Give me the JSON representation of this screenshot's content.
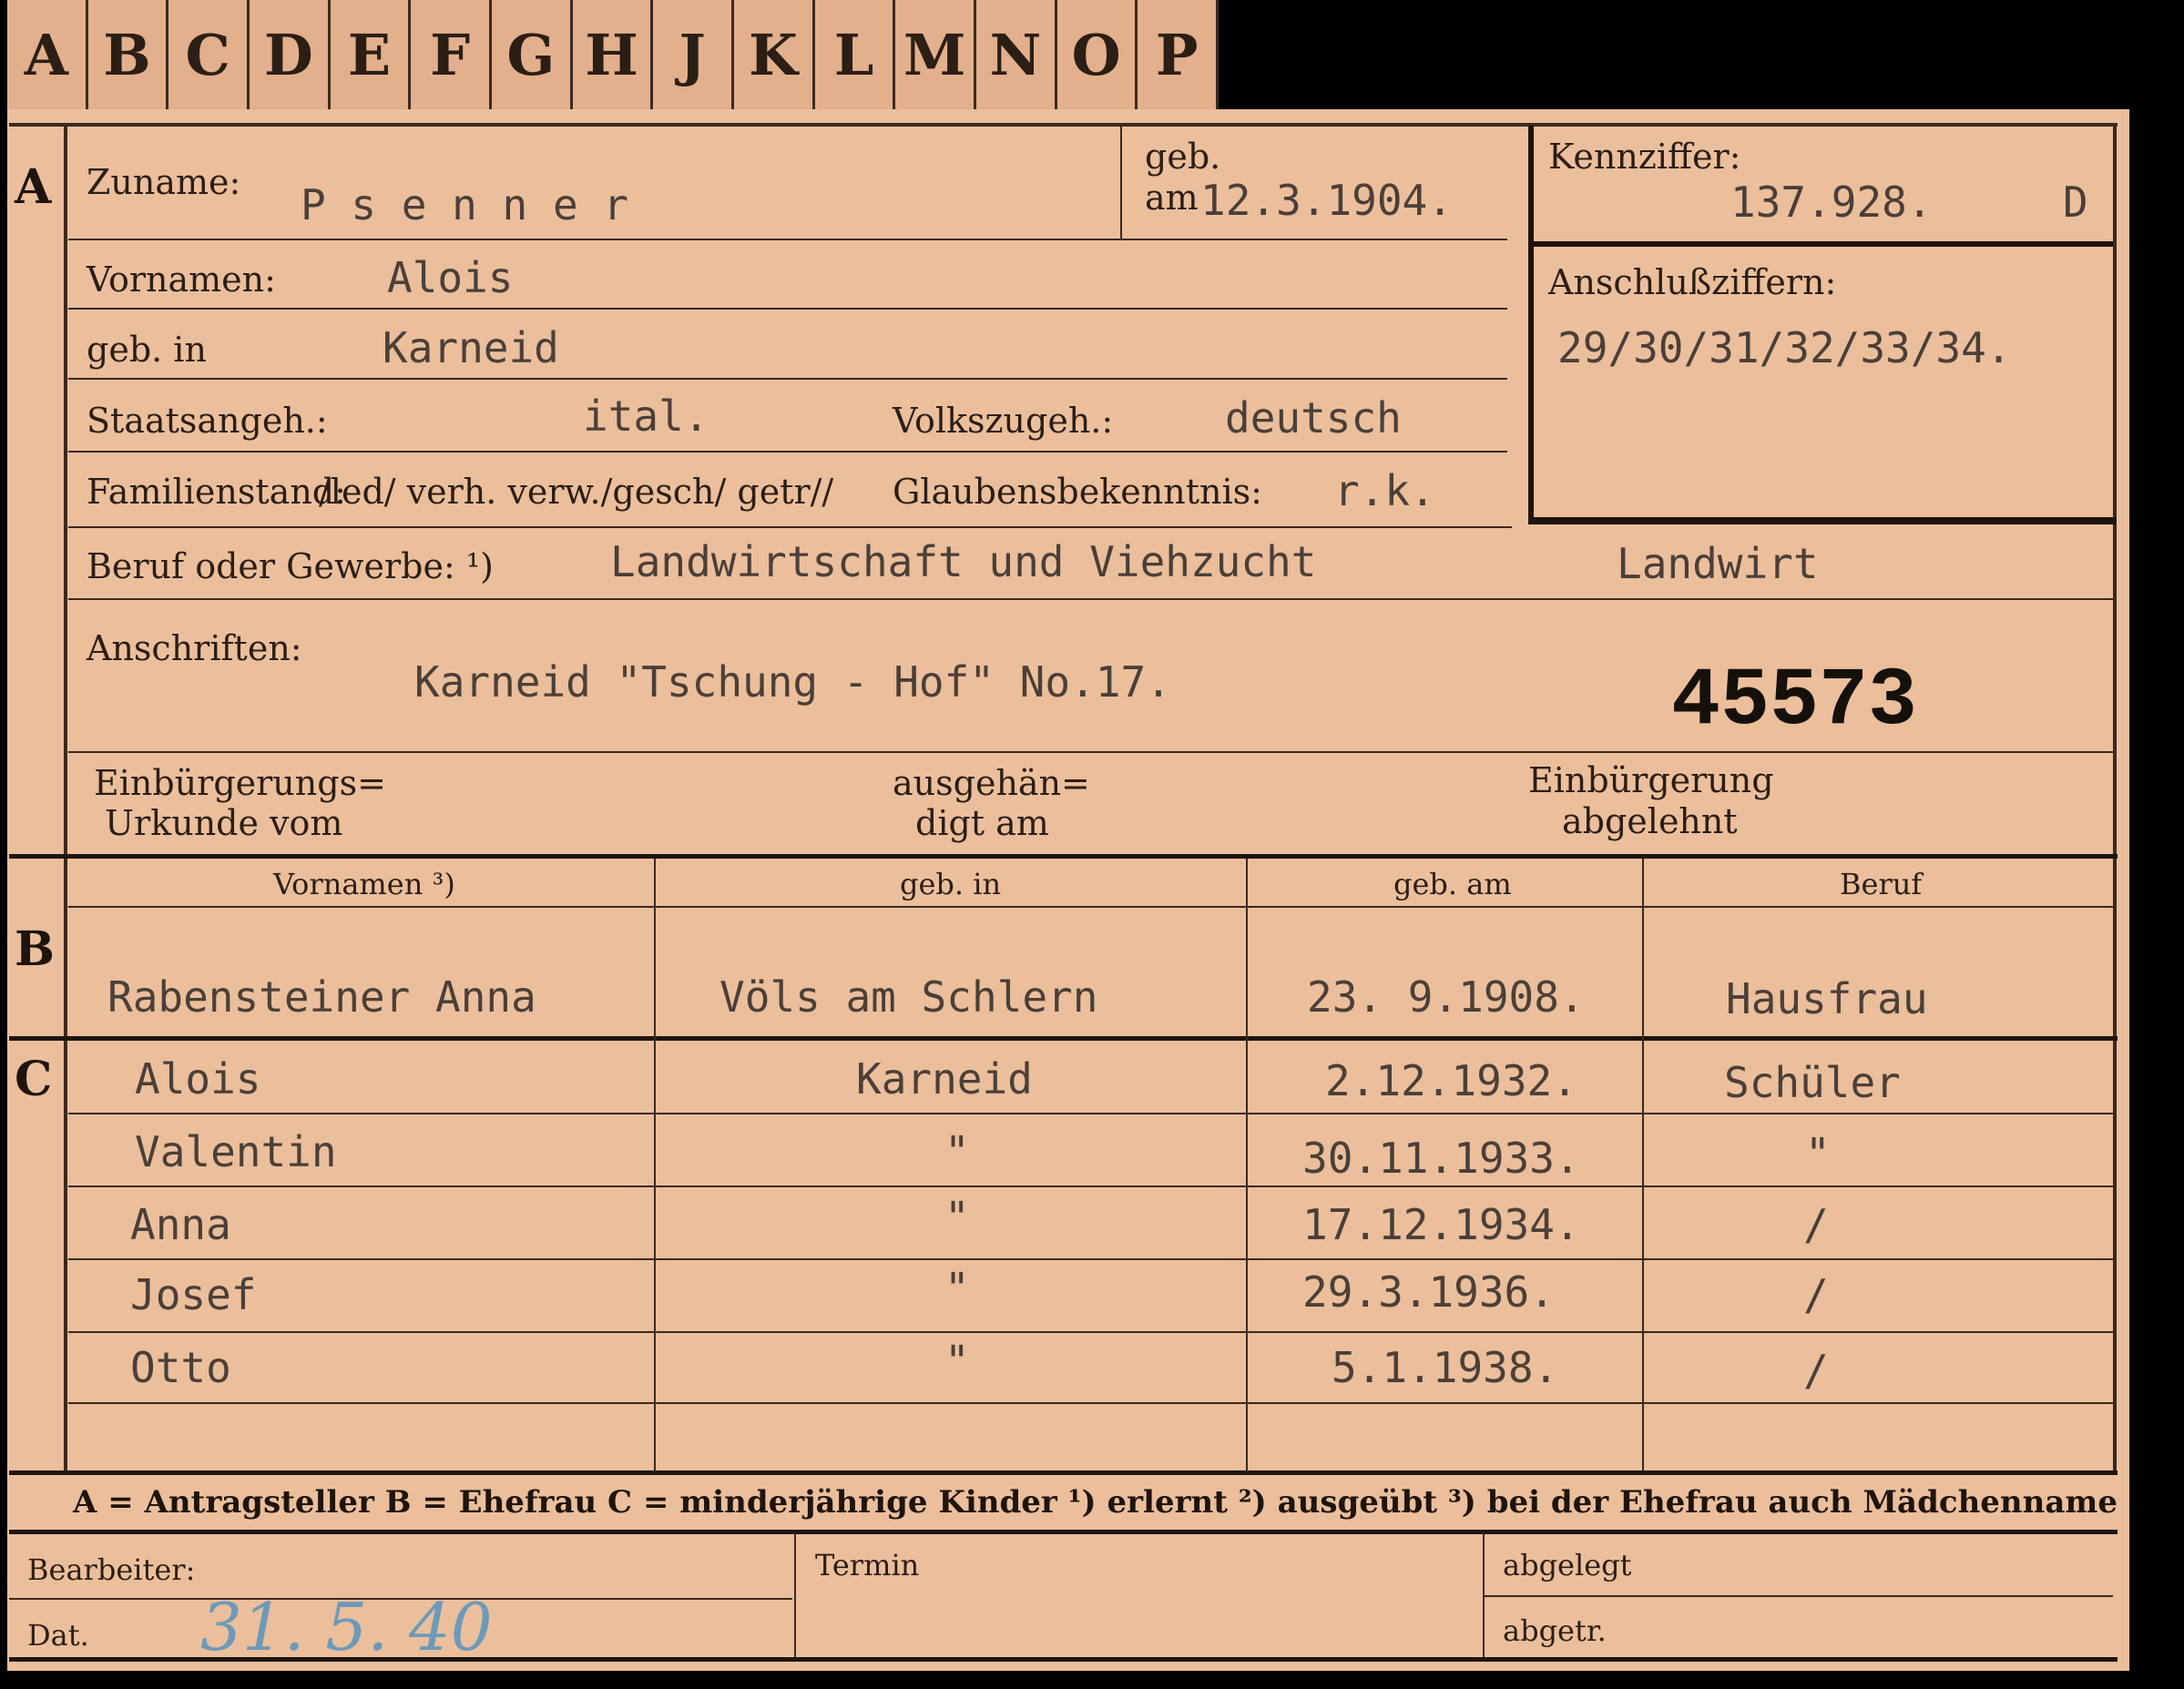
{
  "tabs": [
    "A",
    "B",
    "C",
    "D",
    "E",
    "F",
    "G",
    "H",
    "J",
    "K",
    "L",
    "M",
    "N",
    "O",
    "P"
  ],
  "sections": {
    "a": "A",
    "b": "B",
    "c": "C"
  },
  "header": {
    "surname_label": "Zuname:",
    "surname": "P s e n n e r",
    "geb_label": "geb.",
    "am_label": "am",
    "birth_date": "12.3.1904.",
    "kennziffer_label": "Kennziffer:",
    "kennziffer": "137.928.",
    "kennziffer_suffix": "D",
    "anschluss_label": "Anschlußziffern:",
    "anschluss": "29/30/31/32/33/34.",
    "vornamen_label": "Vornamen:",
    "vornamen": "Alois",
    "gebin_label": "geb. in",
    "gebin": "Karneid",
    "staats_label": "Staatsangeh.:",
    "staats": "ital.",
    "volks_label": "Volkszugeh.:",
    "volks": "deutsch",
    "familien_label": "Familienstand:",
    "familien_options": "/led/ verh. verw./gesch/ getr//",
    "glauben_label": "Glaubensbekenntnis:",
    "glauben": "r.k.",
    "beruf_label": "Beruf oder Gewerbe: ¹)",
    "beruf1": "Landwirtschaft und Viehzucht",
    "beruf2": "Landwirt",
    "anschrift_label": "Anschriften:",
    "anschrift": "Karneid \"Tschung - Hof\" No.17.",
    "stamp_number": "45573",
    "einb_label_1": "Einbürgerungs=",
    "einb_label_2": "Urkunde vom",
    "ausg_label_1": "ausgehän=",
    "ausg_label_2": "digt am",
    "abgelehnt_1": "Einbürgerung",
    "abgelehnt_2": "abgelehnt"
  },
  "spouse_table": {
    "headers": [
      "Vornamen ³)",
      "geb. in",
      "geb. am",
      "Beruf"
    ],
    "row": [
      "Rabensteiner  Anna",
      "Völs am Schlern",
      "23. 9.1908.",
      "Hausfrau"
    ]
  },
  "children": [
    [
      "Alois",
      "Karneid",
      "2.12.1932.",
      "Schüler"
    ],
    [
      "Valentin",
      "\"",
      "30.11.1933.",
      "\""
    ],
    [
      "Anna",
      "\"",
      "17.12.1934.",
      "/"
    ],
    [
      "Josef",
      "\"",
      "29.3.1936.",
      "/"
    ],
    [
      "Otto",
      "\"",
      "5.1.1938.",
      "/"
    ]
  ],
  "legend": "A = Antragsteller   B = Ehefrau   C = minderjährige Kinder   ¹) erlernt   ²) ausgeübt   ³) bei der Ehefrau auch Mädchenname",
  "footer": {
    "bearbeiter_label": "Bearbeiter:",
    "dat_label": "Dat.",
    "dat_value": "31. 5. 40",
    "termin_label": "Termin",
    "abgelegt_label": "abgelegt",
    "abgetr_label": "abgetr."
  }
}
